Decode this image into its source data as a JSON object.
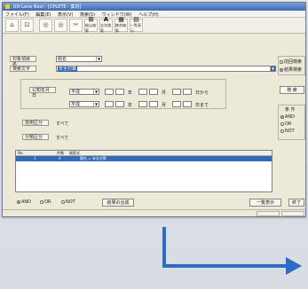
{
  "window": {
    "title": "DD-Lane Navi - [CPLETE - 案内]",
    "menu": [
      "ファイル(F)",
      "編集(E)",
      "表示(V)",
      "検索(S)",
      "ウィンドウ(W)",
      "ヘルプ(H)"
    ]
  },
  "toolbar": {
    "buttons": [
      {
        "glyph": "⌂",
        "label": ""
      },
      {
        "glyph": "⊡",
        "label": ""
      },
      {
        "glyph": "◎",
        "label": ""
      },
      {
        "glyph": "◎",
        "label": ""
      },
      {
        "glyph": "✂",
        "label": ""
      },
      {
        "glyph": "⊞",
        "label": "絞込検索"
      },
      {
        "glyph": "A",
        "label": "全文検索"
      },
      {
        "glyph": "▦",
        "label": "総合検索"
      },
      {
        "glyph": "▤",
        "label": "一覧表示"
      }
    ]
  },
  "form": {
    "target_label": "対象項目名",
    "target_value": "題名",
    "keyword_label": "検索文字",
    "keyword_value": "安全対策",
    "date_label": "公知年月日",
    "era_value": "平成",
    "year": "年",
    "month": "月",
    "from": "日から",
    "to": "日まで",
    "category_label": "技術区分",
    "category_value": "すべて",
    "class_label": "分類区分",
    "class_value": "すべて"
  },
  "right_panel": {
    "mode_options": [
      "前回検索",
      "結果検索"
    ],
    "search_button": "検 索",
    "condition_title": "条 件",
    "logic_options": [
      "AND",
      "OR",
      "NOT"
    ]
  },
  "list": {
    "columns": [
      "No.",
      "件数",
      "検索式"
    ],
    "rows": [
      {
        "no": "1",
        "count": "4",
        "expr": "題名 = 安全対策"
      }
    ]
  },
  "bottom": {
    "logic_options": [
      "AND",
      "OR",
      "NOT"
    ],
    "combine_button": "結果の合成",
    "list_button": "一覧表示",
    "close_button": "終了"
  },
  "colors": {
    "accent": "#2d6cc0",
    "selection": "#3569b8",
    "arrow": "#2d6cc0"
  }
}
